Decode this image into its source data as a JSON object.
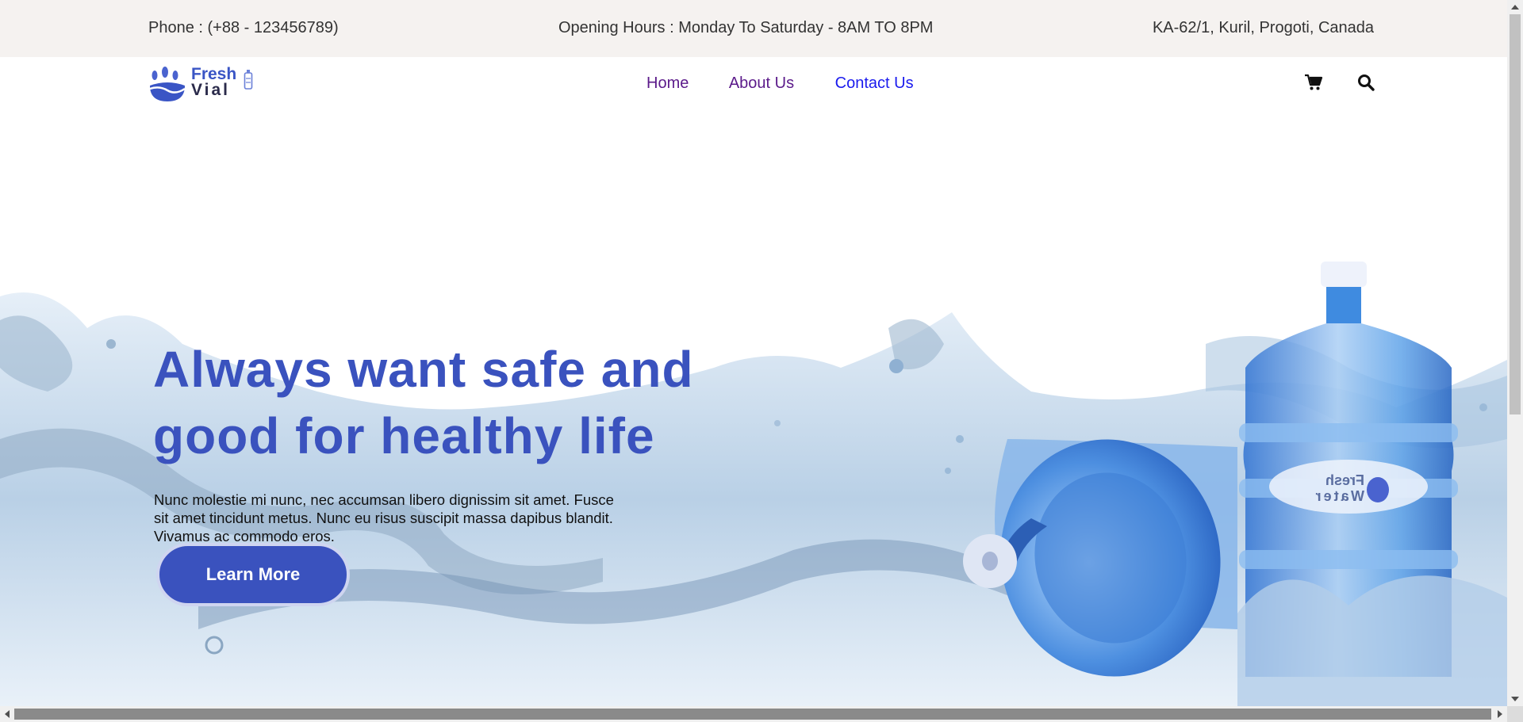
{
  "topbar": {
    "phone": "Phone : (+88 - 123456789)",
    "hours": "Opening Hours : Monday To Saturday - 8AM TO 8PM",
    "address": "KA-62/1, Kuril, Progoti, Canada"
  },
  "logo": {
    "line1": "Fresh",
    "line2": "Vial",
    "icon": "water-drops-logo-icon"
  },
  "nav": {
    "home": "Home",
    "about": "About Us",
    "contact": "Contact Us",
    "cart_icon": "cart-icon",
    "search_icon": "search-icon"
  },
  "hero": {
    "headline_line1": "Always want safe and",
    "headline_line2": "good for healthy life",
    "body": "Nunc molestie mi nunc, nec accumsan libero dignissim sit amet. Fusce sit amet tincidunt metus. Nunc eu risus suscipit massa dapibus blandit. Vivamus ac commodo eros.",
    "cta": "Learn More",
    "bottle_label_1": "Fresh",
    "bottle_label_2": "Water"
  },
  "colors": {
    "topbar_bg": "#f5f2f0",
    "accent_blue": "#3a52be",
    "nav_visited": "#5b1a8a",
    "nav_link": "#1a1aee"
  }
}
